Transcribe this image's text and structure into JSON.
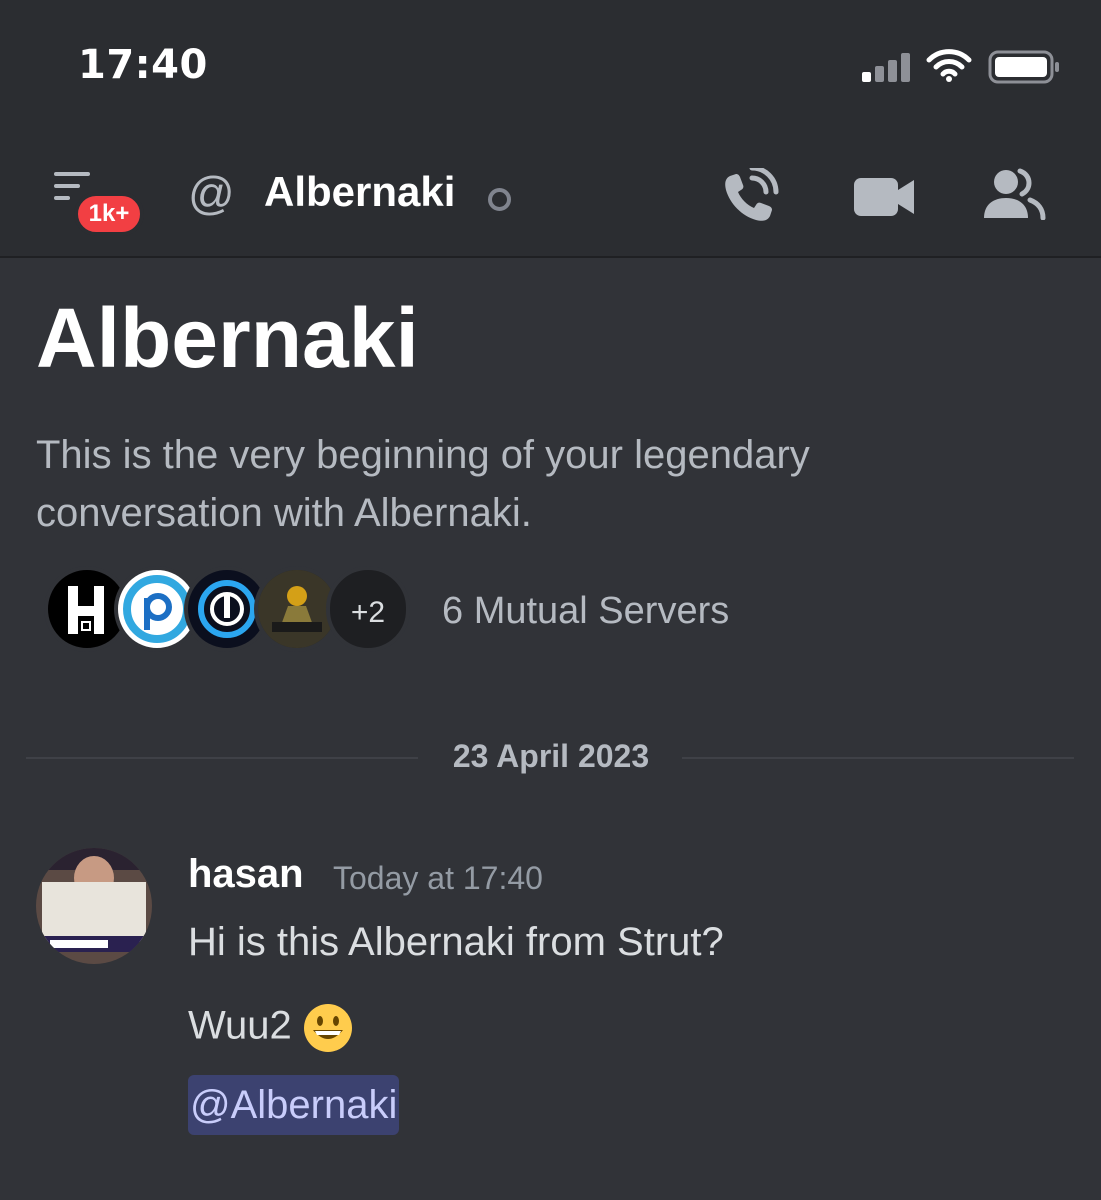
{
  "status_bar": {
    "time": "17:40"
  },
  "header": {
    "badge": "1k+",
    "at_symbol": "@",
    "title": "Albernaki"
  },
  "intro": {
    "title": "Albernaki",
    "description": "This is the very beginning of your legendary conversation with Albernaki.",
    "servers_overflow": "+2",
    "mutual_servers": "6 Mutual Servers"
  },
  "divider": {
    "date": "23 April 2023"
  },
  "message": {
    "author": "hasan",
    "timestamp": "Today at 17:40",
    "lines": [
      "Hi is this Albernaki from Strut?",
      "Wuu2"
    ],
    "mention": "@Albernaki"
  },
  "colors": {
    "background": "#313338",
    "header": "#2b2d31",
    "badge": "#f23f43",
    "mention_bg": "#3c4270",
    "mention_text": "#c9cdfb"
  }
}
